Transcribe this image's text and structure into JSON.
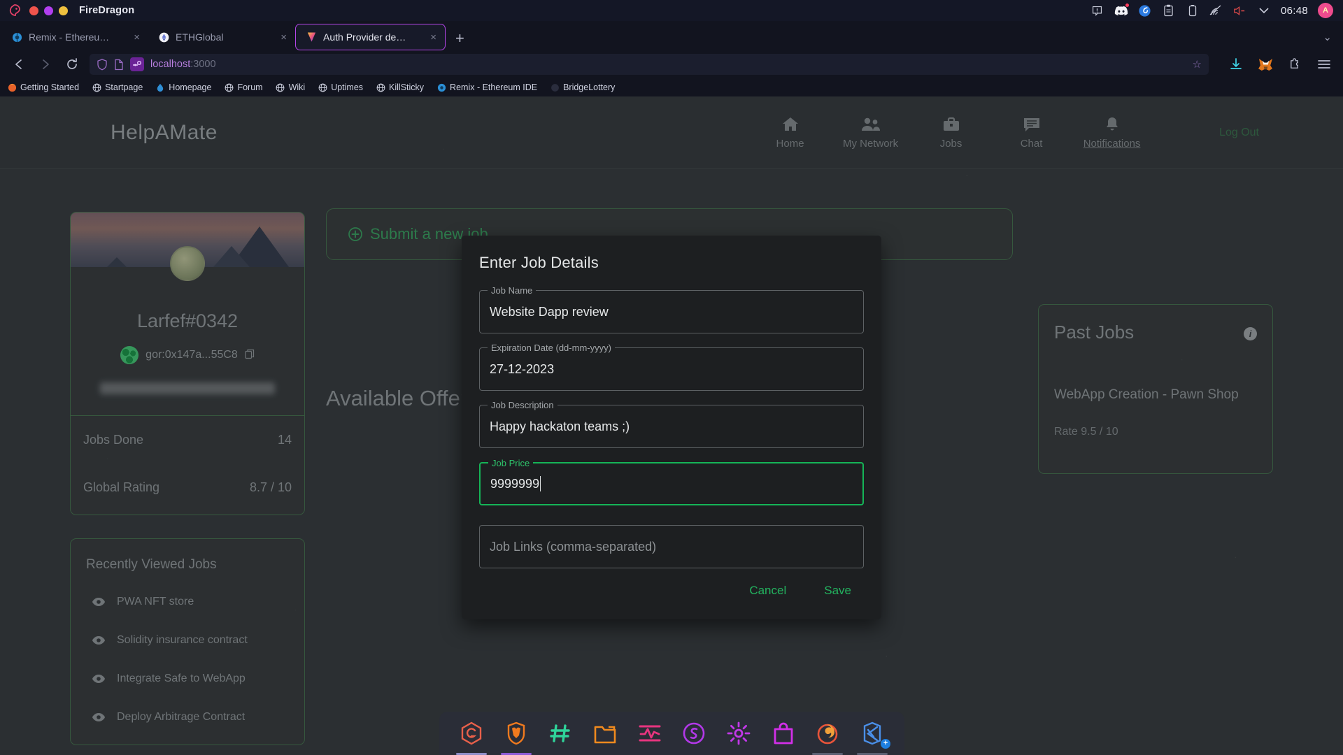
{
  "os": {
    "app_name": "FireDragon",
    "window_buttons": [
      "close",
      "maximize",
      "minimize"
    ],
    "tray": {
      "icons": [
        "alert-icon",
        "discord-icon",
        "sync-icon",
        "clipboard-icon",
        "battery-icon",
        "wifi-icon",
        "volume-muted-icon",
        "chevron-down-icon"
      ],
      "clock": "06:48",
      "avatar_initial": "A"
    }
  },
  "browser": {
    "tabs": [
      {
        "title": "Remix - Ethereum IDE",
        "favicon": "remix-icon",
        "close": "×",
        "active": false
      },
      {
        "title": "ETHGlobal",
        "favicon": "ethglobal-icon",
        "close": "×",
        "active": false
      },
      {
        "title": "Auth Provider demo",
        "favicon": "vercel-icon",
        "close": "×",
        "active": true
      }
    ],
    "new_tab_label": "+",
    "tabstrip_overflow": "⌄",
    "nav": {
      "back": "←",
      "forward": "→",
      "reload": "⟳"
    },
    "omnibox": {
      "host": "localhost",
      "port": ":3000",
      "star": "☆",
      "icons": [
        "shield-icon",
        "page-info-icon",
        "permissions-icon"
      ]
    },
    "toolbar_right": [
      "downloads-icon",
      "metamask-icon",
      "extensions-icon",
      "menu-icon"
    ],
    "bookmarks": [
      {
        "label": "Getting Started",
        "icon": "firefox-icon"
      },
      {
        "label": "Startpage",
        "icon": "globe-icon"
      },
      {
        "label": "Homepage",
        "icon": "water-drop-icon"
      },
      {
        "label": "Forum",
        "icon": "globe-icon"
      },
      {
        "label": "Wiki",
        "icon": "globe-icon"
      },
      {
        "label": "Uptimes",
        "icon": "globe-icon"
      },
      {
        "label": "KillSticky",
        "icon": "globe-icon"
      },
      {
        "label": "Remix - Ethereum IDE",
        "icon": "remix-icon"
      },
      {
        "label": "BridgeLottery",
        "icon": "dark-globe-icon"
      }
    ]
  },
  "app": {
    "brand": "HelpAMate",
    "nav": [
      {
        "label": "Home",
        "icon": "home-icon",
        "active": false
      },
      {
        "label": "My Network",
        "icon": "people-icon",
        "active": false
      },
      {
        "label": "Jobs",
        "icon": "briefcase-icon",
        "active": false
      },
      {
        "label": "Chat",
        "icon": "chat-icon",
        "active": false
      },
      {
        "label": "Notifications",
        "icon": "bell-icon",
        "active": true
      }
    ],
    "logout_label": "Log Out",
    "profile": {
      "name": "Larfef#0342",
      "wallet": "gor:0x147a...55C8",
      "copy_icon": "copy-icon",
      "email_blurred": true,
      "stats": [
        {
          "label": "Jobs Done",
          "value": "14"
        },
        {
          "label": "Global Rating",
          "value": "8.7 / 10"
        }
      ]
    },
    "recently_viewed": {
      "title": "Recently Viewed Jobs",
      "items": [
        {
          "label": "PWA NFT store",
          "icon": "eye-icon"
        },
        {
          "label": "Solidity insurance contract",
          "icon": "eye-icon"
        },
        {
          "label": "Integrate Safe to WebApp",
          "icon": "eye-icon"
        },
        {
          "label": "Deploy Arbitrage Contract",
          "icon": "eye-icon"
        }
      ]
    },
    "main": {
      "submit_label": "Submit a new job",
      "submit_icon": "plus-circle-icon",
      "section_title": "Available Offers"
    },
    "past_jobs": {
      "title": "Past Jobs",
      "info_icon": "info-icon",
      "items": [
        {
          "name": "WebApp Creation - Pawn Shop",
          "rate": "Rate 9.5 / 10"
        }
      ]
    },
    "modal": {
      "title": "Enter Job Details",
      "fields": [
        {
          "label": "Job Name",
          "value": "Website Dapp review",
          "placeholder": "",
          "focused": false
        },
        {
          "label": "Expiration Date (dd-mm-yyyy)",
          "value": "27-12-2023",
          "placeholder": "",
          "focused": false
        },
        {
          "label": "Job Description",
          "value": "Happy hackaton teams ;)",
          "placeholder": "",
          "focused": false
        },
        {
          "label": "Job Price",
          "value": "9999999",
          "placeholder": "",
          "focused": true
        },
        {
          "label": "",
          "value": "",
          "placeholder": "Job Links (comma-separated)",
          "focused": false
        }
      ],
      "cancel_label": "Cancel",
      "save_label": "Save"
    }
  },
  "dock": {
    "items": [
      {
        "name": "gitlab-icon",
        "color": "#e8604a",
        "running": true,
        "indicator": "#8e8ec8"
      },
      {
        "name": "brave-icon",
        "color": "#f07a1e",
        "running": true,
        "indicator": "#8d5bd6"
      },
      {
        "name": "hash-icon",
        "color": "#2fd39a",
        "running": false,
        "indicator": ""
      },
      {
        "name": "folder-icon",
        "color": "#f08a1e",
        "running": false,
        "indicator": ""
      },
      {
        "name": "monitor-icon",
        "color": "#e8357f",
        "running": false,
        "indicator": ""
      },
      {
        "name": "spotify-icon",
        "color": "#b238e8",
        "running": false,
        "indicator": ""
      },
      {
        "name": "settings-icon",
        "color": "#c238e8",
        "running": false,
        "indicator": ""
      },
      {
        "name": "store-icon",
        "color": "#d22fe8",
        "running": false,
        "indicator": ""
      },
      {
        "name": "firefox-icon",
        "color": "#e8543a",
        "running": true,
        "indicator": "#5a5f72"
      },
      {
        "name": "vscode-icon",
        "color": "#4a8fe8",
        "running": true,
        "indicator": "#5a5f72",
        "badge": "+"
      }
    ]
  },
  "colors": {
    "accent_green": "#23b35f",
    "focus_green": "#15b457",
    "card_border": "#4c7a56",
    "page_bg": "#3c4246",
    "modal_bg": "#1d1f21",
    "tab_active_border": "#b445e8",
    "omnibox_text": "#b87fe0"
  }
}
